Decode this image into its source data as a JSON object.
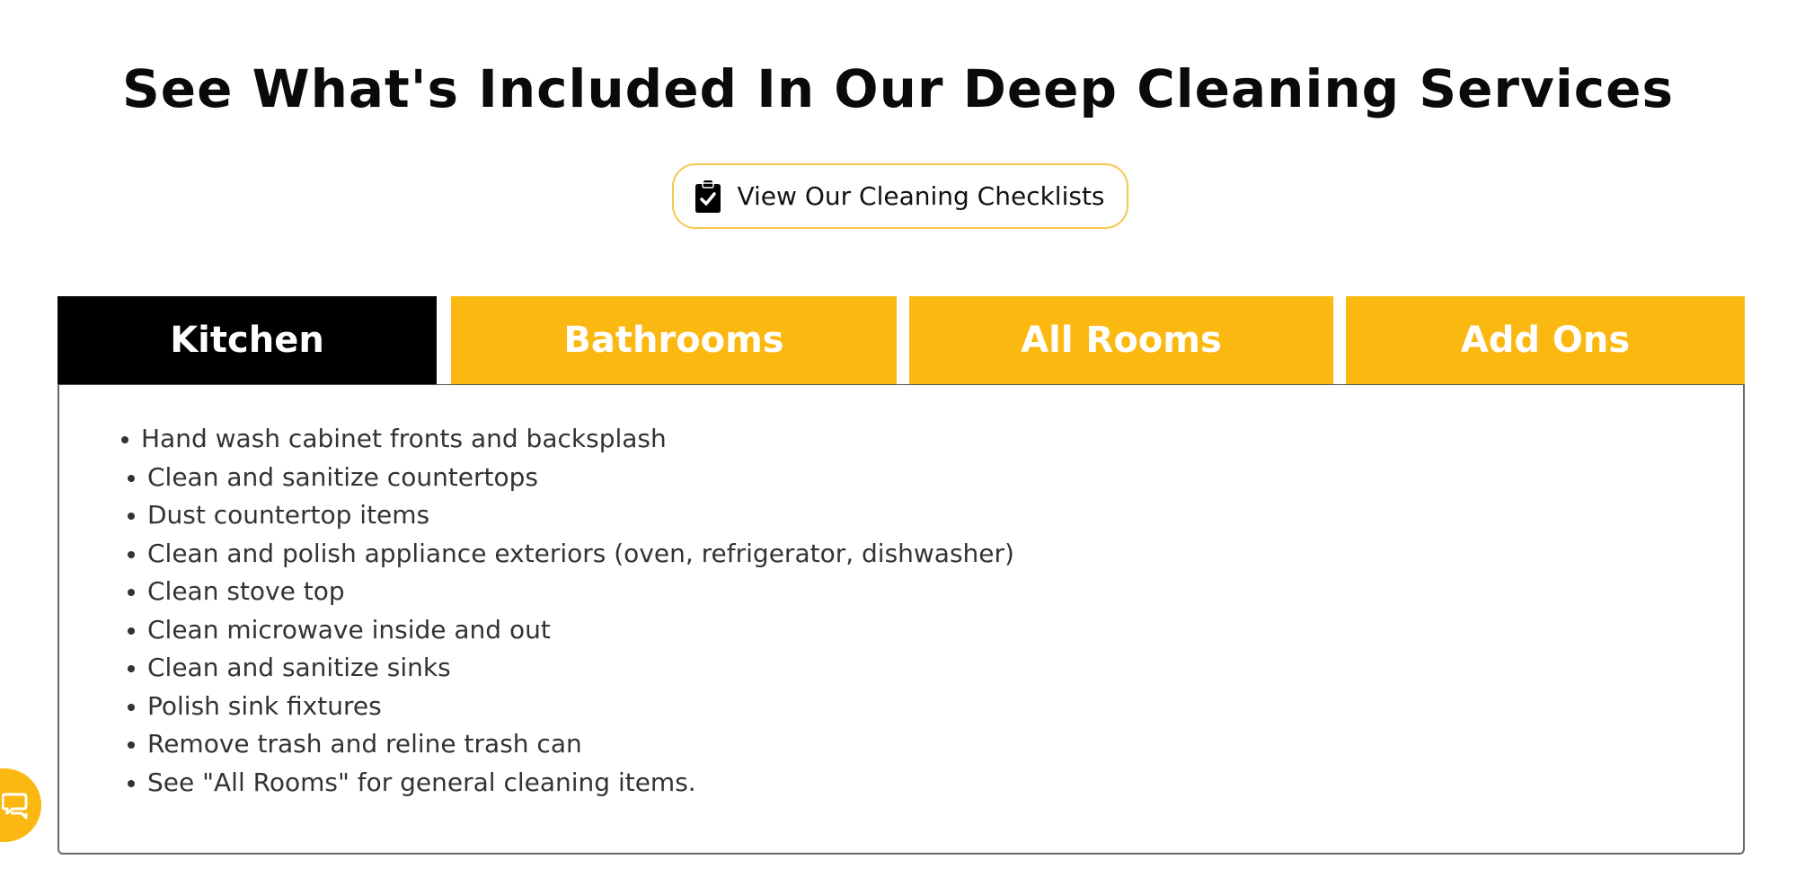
{
  "heading": "See What's Included In Our Deep Cleaning Services",
  "checklist_button": {
    "label": "View Our Cleaning Checklists",
    "icon": "clipboard-check-icon",
    "border_color": "#f5c84a"
  },
  "tabs": [
    {
      "label": "Kitchen",
      "active": true
    },
    {
      "label": "Bathrooms",
      "active": false
    },
    {
      "label": "All Rooms",
      "active": false
    },
    {
      "label": "Add Ons",
      "active": false
    }
  ],
  "kitchen_items": [
    "Hand wash cabinet fronts and backsplash",
    "Clean and sanitize countertops",
    "Dust countertop items",
    "Clean and polish appliance exteriors (oven, refrigerator, dishwasher)",
    "Clean stove top",
    "Clean microwave inside and out",
    "Clean and sanitize sinks",
    "Polish sink fixtures",
    "Remove trash and reline trash can",
    "See \"All Rooms\" for general cleaning items."
  ],
  "chat_button": {
    "icon": "chat-icon"
  },
  "colors": {
    "accent": "#fbb810",
    "active_tab": "#000000",
    "tab_text": "#ffffff",
    "body_text": "#333333"
  }
}
